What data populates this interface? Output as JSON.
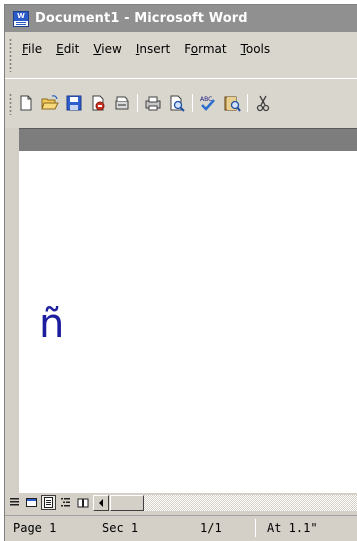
{
  "window": {
    "title": "Document1 - Microsoft Word",
    "app_icon_letter": "W"
  },
  "menubar": {
    "items": [
      {
        "label": "File",
        "mnemonic": "F",
        "rest": "ile"
      },
      {
        "label": "Edit",
        "mnemonic": "E",
        "rest": "dit"
      },
      {
        "label": "View",
        "mnemonic": "V",
        "rest": "iew"
      },
      {
        "label": "Insert",
        "mnemonic": "I",
        "rest": "nsert"
      },
      {
        "label": "Format",
        "pre": "F",
        "mnemonic": "o",
        "rest": "rmat"
      },
      {
        "label": "Tools",
        "mnemonic": "T",
        "rest": "ools"
      }
    ]
  },
  "toolbar": {
    "icons": [
      "new-document-icon",
      "open-folder-icon",
      "save-icon",
      "permission-icon",
      "email-icon",
      "print-icon",
      "print-preview-icon",
      "spelling-grammar-icon",
      "research-icon",
      "cut-icon"
    ]
  },
  "document": {
    "content": "ñ",
    "text_color": "#1d1d9f"
  },
  "viewbar": {
    "buttons": [
      "normal-view-icon",
      "web-layout-icon",
      "print-layout-icon",
      "outline-view-icon",
      "reading-layout-icon"
    ],
    "active": "print-layout-icon"
  },
  "statusbar": {
    "page": "Page 1",
    "section": "Sec 1",
    "page_count": "1/1",
    "position": "At 1.1\""
  },
  "colors": {
    "titlebar_inactive": "#909090",
    "chrome": "#d4d0c8",
    "ruler_dark": "#7d7d7d"
  }
}
